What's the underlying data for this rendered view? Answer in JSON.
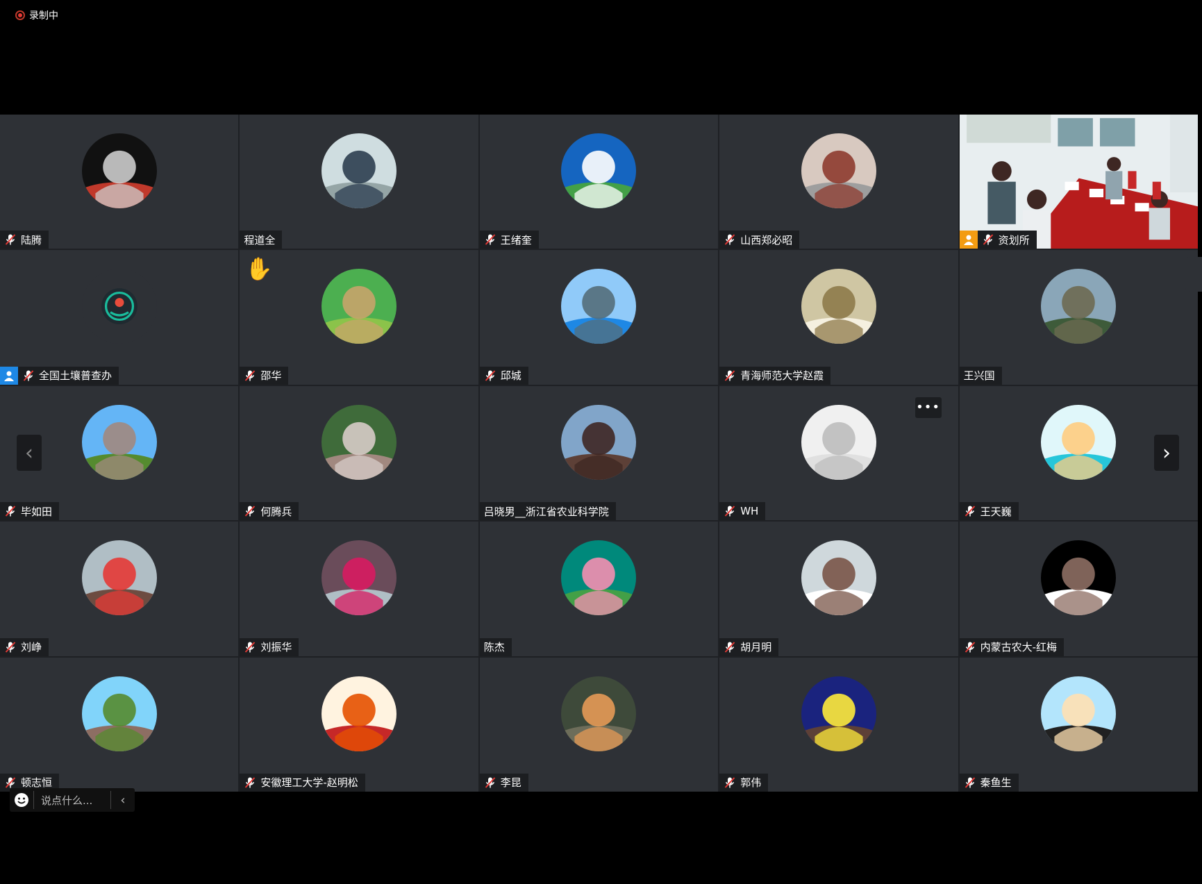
{
  "recording": {
    "label": "录制中"
  },
  "chat": {
    "placeholder": "说点什么..."
  },
  "participants": [
    {
      "name": "陆腾",
      "mic": true,
      "avatar": {
        "bg": "#111",
        "fg": "#ccc",
        "accent": "#c0392b"
      }
    },
    {
      "name": "程道全",
      "mic": false,
      "avatar": {
        "bg": "#cfdde0",
        "fg": "#2c3e50",
        "accent": "#95a5a6"
      }
    },
    {
      "name": "王绪奎",
      "mic": true,
      "avatar": {
        "bg": "#1565c0",
        "fg": "#ffffff",
        "accent": "#43a047"
      }
    },
    {
      "name": "山西郑必昭",
      "mic": true,
      "avatar": {
        "bg": "#d8c9c0",
        "fg": "#8e3b2f",
        "accent": "#9e9e9e"
      }
    },
    {
      "name": "资划所",
      "mic": true,
      "camera": true,
      "host": "orange"
    },
    {
      "name": "全国土壤普查办",
      "mic": true,
      "host": "blue",
      "avatar": {
        "bg": "#2e3136",
        "fg": "#1abc9c",
        "accent": "#e74c3c",
        "small": true
      }
    },
    {
      "name": "邵华",
      "mic": true,
      "raised_hand": true,
      "avatar": {
        "bg": "#4caf50",
        "fg": "#c8a46a",
        "accent": "#8bc34a"
      }
    },
    {
      "name": "邱城",
      "mic": true,
      "avatar": {
        "bg": "#90caf9",
        "fg": "#546e7a",
        "accent": "#1e88e5"
      }
    },
    {
      "name": "青海师范大学赵霞",
      "mic": true,
      "avatar": {
        "bg": "#cfc6a3",
        "fg": "#8d7a4a",
        "accent": "#f5f0e0"
      }
    },
    {
      "name": "王兴国",
      "mic": false,
      "avatar": {
        "bg": "#8aa6b8",
        "fg": "#6d6a52",
        "accent": "#3e5b3a"
      }
    },
    {
      "name": "毕如田",
      "mic": true,
      "avatar": {
        "bg": "#64b5f6",
        "fg": "#a1887f",
        "accent": "#558b2f"
      }
    },
    {
      "name": "何腾兵",
      "mic": true,
      "avatar": {
        "bg": "#3f6b3a",
        "fg": "#d7ccc8",
        "accent": "#a1887f"
      }
    },
    {
      "name": "吕晓男__浙江省农业科学院",
      "mic": false,
      "avatar": {
        "bg": "#81a5c9",
        "fg": "#3e2723",
        "accent": "#5d4037"
      }
    },
    {
      "name": "WH",
      "mic": true,
      "more": true,
      "avatar": {
        "bg": "#f0f0f0",
        "fg": "#bdbdbd",
        "accent": "#e0e0e0"
      }
    },
    {
      "name": "王天巍",
      "mic": true,
      "avatar": {
        "bg": "#e0f7fa",
        "fg": "#ffcc80",
        "accent": "#26c6da"
      }
    },
    {
      "name": "刘峥",
      "mic": true,
      "avatar": {
        "bg": "#b0bec5",
        "fg": "#e53935",
        "accent": "#6d4c41"
      }
    },
    {
      "name": "刘振华",
      "mic": true,
      "avatar": {
        "bg": "#6a4c5a",
        "fg": "#d81b60",
        "accent": "#b0bec5"
      }
    },
    {
      "name": "陈杰",
      "mic": false,
      "avatar": {
        "bg": "#00897b",
        "fg": "#f48fb1",
        "accent": "#43a047"
      }
    },
    {
      "name": "胡月明",
      "mic": true,
      "avatar": {
        "bg": "#cfd8dc",
        "fg": "#795548",
        "accent": "#ffffff"
      }
    },
    {
      "name": "内蒙古农大-红梅",
      "mic": true,
      "avatar": {
        "bg": "#000000",
        "fg": "#8d6e63",
        "accent": "#ffffff"
      }
    },
    {
      "name": "顿志恒",
      "mic": true,
      "avatar": {
        "bg": "#81d4fa",
        "fg": "#558b2f",
        "accent": "#8d6e63"
      }
    },
    {
      "name": "安徽理工大学-赵明松",
      "mic": true,
      "avatar": {
        "bg": "#fff3e0",
        "fg": "#e65100",
        "accent": "#c62828"
      }
    },
    {
      "name": "李昆",
      "mic": true,
      "avatar": {
        "bg": "#3e4a3a",
        "fg": "#e59a56",
        "accent": "#6d6d5a"
      }
    },
    {
      "name": "郭伟",
      "mic": true,
      "avatar": {
        "bg": "#1a237e",
        "fg": "#ffeb3b",
        "accent": "#5d4037"
      }
    },
    {
      "name": "秦鱼生",
      "mic": true,
      "avatar": {
        "bg": "#b3e5fc",
        "fg": "#ffe0b2",
        "accent": "#212121"
      }
    }
  ]
}
